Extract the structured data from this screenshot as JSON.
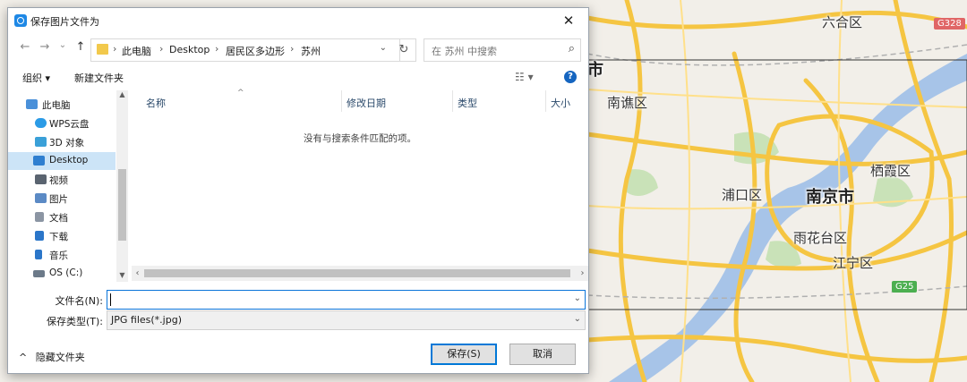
{
  "map": {
    "labels": [
      {
        "id": "liuhe",
        "text": "六合区"
      },
      {
        "id": "nanqiao",
        "text": "南谯区"
      },
      {
        "id": "qixia",
        "text": "栖霞区"
      },
      {
        "id": "pukou",
        "text": "浦口区"
      },
      {
        "id": "nanjing",
        "text": "南京市"
      },
      {
        "id": "yuhuatai",
        "text": "雨花台区"
      },
      {
        "id": "jiangning",
        "text": "江宁区"
      },
      {
        "id": "shi_partial",
        "text": "市"
      }
    ],
    "shields": [
      {
        "id": "g328",
        "text": "G328",
        "color": "#e06666"
      },
      {
        "id": "g25",
        "text": "G25",
        "color": "#4caf50"
      }
    ]
  },
  "dialog": {
    "title": "保存图片文件为",
    "close_symbol": "✕",
    "nav": {
      "back": "←",
      "forward": "→",
      "recent": "⌄",
      "up": "↑",
      "breadcrumbs": [
        "此电脑",
        "Desktop",
        "居民区多边形",
        "苏州"
      ],
      "refresh": "↻",
      "search_placeholder": "在 苏州 中搜索",
      "search_icon": "⌕"
    },
    "toolbar": {
      "organize": "组织 ▾",
      "new_folder": "新建文件夹",
      "view_icon": "☷ ▾",
      "help_icon": "?"
    },
    "nav_pane": [
      {
        "label": "此电脑",
        "icon": "computer-icon",
        "color": "#4a90d9"
      },
      {
        "label": "WPS云盘",
        "icon": "cloud-icon",
        "color": "#2b9be6"
      },
      {
        "label": "3D 对象",
        "icon": "cube-icon",
        "color": "#3aa0d8"
      },
      {
        "label": "Desktop",
        "icon": "desktop-icon",
        "color": "#2f7fd0",
        "selected": true
      },
      {
        "label": "视频",
        "icon": "video-icon",
        "color": "#5a6470"
      },
      {
        "label": "图片",
        "icon": "pictures-icon",
        "color": "#5b8ac5"
      },
      {
        "label": "文档",
        "icon": "documents-icon",
        "color": "#8b95a3"
      },
      {
        "label": "下载",
        "icon": "download-icon",
        "color": "#2b76c9"
      },
      {
        "label": "音乐",
        "icon": "music-icon",
        "color": "#2b76c9"
      },
      {
        "label": "OS (C:)",
        "icon": "drive-icon",
        "color": "#6c7a89"
      }
    ],
    "columns": [
      "名称",
      "修改日期",
      "类型",
      "大小"
    ],
    "empty_message": "没有与搜索条件匹配的项。",
    "form": {
      "filename_label": "文件名(N):",
      "filename_value": "",
      "filetype_label": "保存类型(T):",
      "filetype_value": "JPG files(*.jpg)"
    },
    "hide_folders": "隐藏文件夹",
    "save_button": "保存(S)",
    "cancel_button": "取消"
  }
}
